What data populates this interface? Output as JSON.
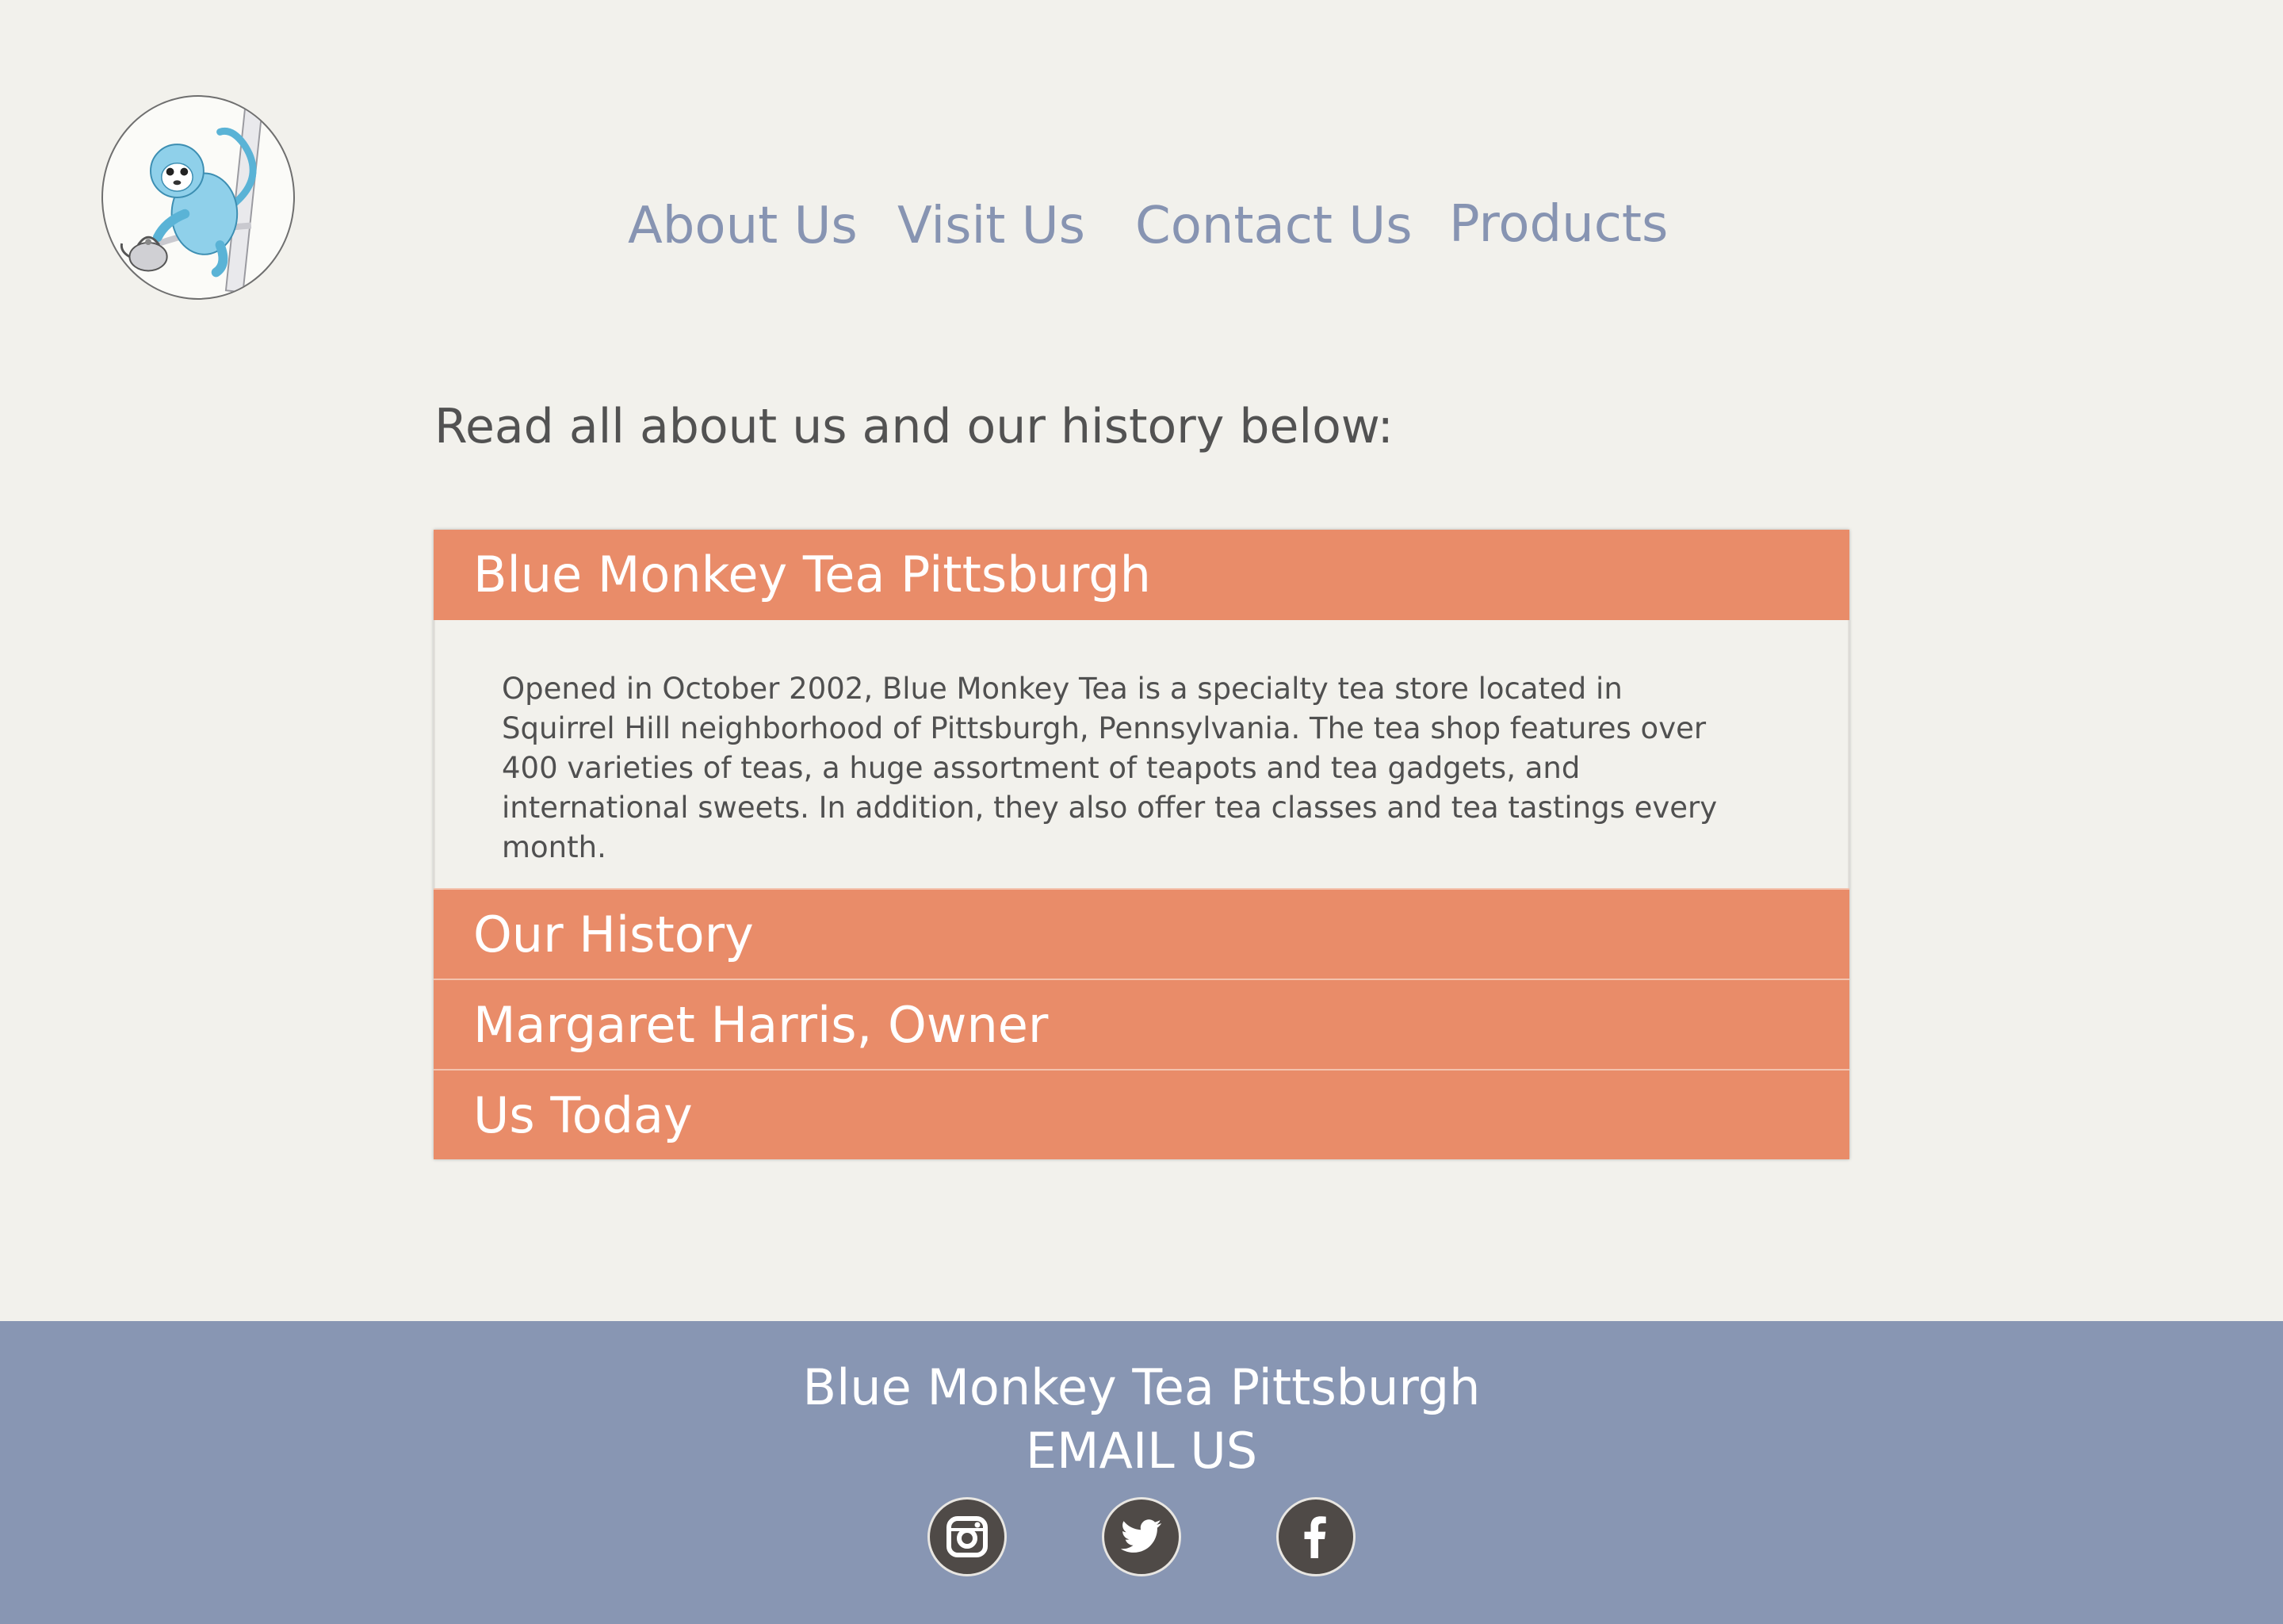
{
  "brand": {
    "logo_icon": "blue-monkey-with-teapot-logo"
  },
  "nav": {
    "items": [
      {
        "label": "About Us"
      },
      {
        "label": "Visit Us"
      },
      {
        "label": "Contact Us"
      },
      {
        "label": "Products"
      }
    ]
  },
  "main": {
    "intro": "Read all about us and our history below:",
    "accordion": [
      {
        "title": "Blue Monkey Tea Pittsburgh",
        "expanded": true,
        "body": "Opened in October 2002, Blue Monkey Tea is a specialty tea store located in Squirrel Hill neighborhood of Pittsburgh, Pennsylvania. The tea shop features over 400 varieties of teas, a huge assortment of teapots and tea gadgets, and international sweets. In addition, they also offer tea classes and tea tastings every month."
      },
      {
        "title": "Our History",
        "expanded": false
      },
      {
        "title": "Margaret Harris, Owner",
        "expanded": false
      },
      {
        "title": "Us Today",
        "expanded": false
      }
    ]
  },
  "footer": {
    "title": "Blue Monkey Tea Pittsburgh",
    "email_label": "EMAIL US",
    "social": [
      {
        "icon": "instagram-icon"
      },
      {
        "icon": "twitter-icon"
      },
      {
        "icon": "facebook-icon"
      }
    ]
  },
  "colors": {
    "background": "#f2f1ec",
    "nav_text": "#8794b2",
    "accordion_header": "#e98c69",
    "footer": "#8896b3",
    "social_bg": "#4f4a47"
  }
}
